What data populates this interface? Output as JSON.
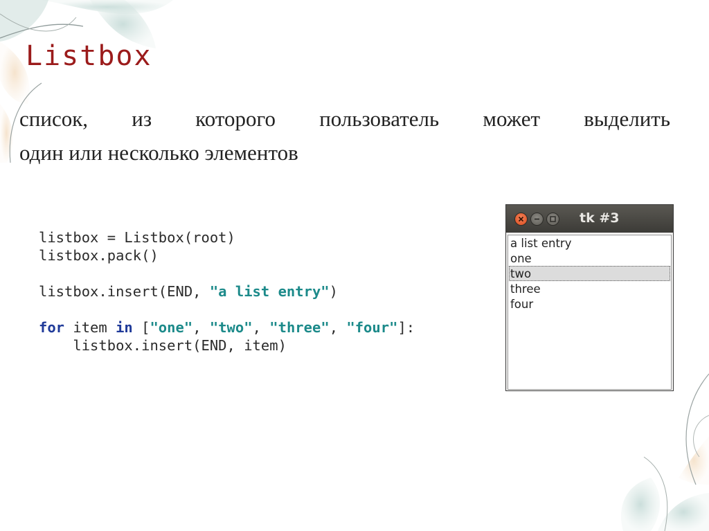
{
  "slide": {
    "title": "Listbox",
    "subtitle_line1": [
      "список,",
      "из",
      "которого",
      "пользователь",
      "может",
      "выделить"
    ],
    "subtitle_line2": "один или несколько элементов"
  },
  "code": {
    "line1": "listbox = Listbox(root)",
    "line2": "listbox.pack()",
    "line3": {
      "pre": "listbox.insert(END, ",
      "str": "\"a list entry\"",
      "post": ")"
    },
    "line4": {
      "kw1": "for",
      "t1": " item ",
      "kw2": "in",
      "t2": " [",
      "s1": "\"one\"",
      "c1": ", ",
      "s2": "\"two\"",
      "c2": ", ",
      "s3": "\"three\"",
      "c3": ", ",
      "s4": "\"four\"",
      "t3": "]:"
    },
    "line5": "    listbox.insert(END, item)"
  },
  "tk_window": {
    "title": "tk #3",
    "buttons": {
      "close": "close-icon",
      "minimize": "minimize-icon",
      "maximize": "maximize-icon"
    },
    "items": [
      "a list entry",
      "one",
      "two",
      "three",
      "four"
    ],
    "selected_item": "two"
  },
  "colors": {
    "title": "#9b1b1b",
    "keyword": "#1f3a99",
    "string": "#1c8a8a",
    "titlebar": "#3c3b37",
    "close_button": "#e05a2b"
  }
}
